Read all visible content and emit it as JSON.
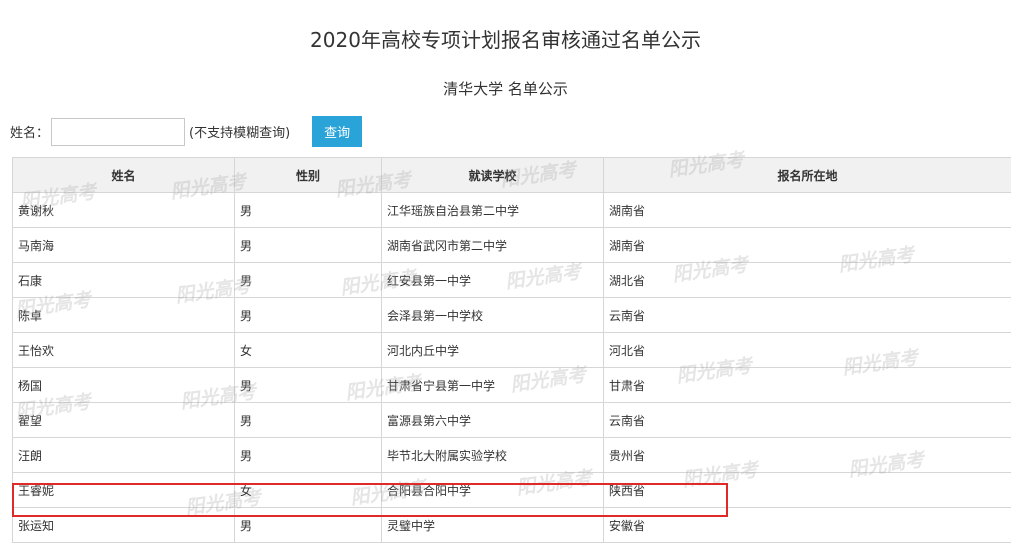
{
  "page": {
    "title": "2020年高校专项计划报名审核通过名单公示",
    "subtitle": "清华大学 名单公示"
  },
  "search": {
    "label": "姓名：",
    "value": "",
    "placeholder": "",
    "note": "(不支持模糊查询)",
    "button_label": "查询"
  },
  "table": {
    "headers": [
      "姓名",
      "性别",
      "就读学校",
      "报名所在地"
    ],
    "rows": [
      [
        "黄谢秋",
        "男",
        "江华瑶族自治县第二中学",
        "湖南省"
      ],
      [
        "马南海",
        "男",
        "湖南省武冈市第二中学",
        "湖南省"
      ],
      [
        "石康",
        "男",
        "红安县第一中学",
        "湖北省"
      ],
      [
        "陈卓",
        "男",
        "会泽县第一中学校",
        "云南省"
      ],
      [
        "王怡欢",
        "女",
        "河北内丘中学",
        "河北省"
      ],
      [
        "杨国",
        "男",
        "甘肃省宁县第一中学",
        "甘肃省"
      ],
      [
        "翟望",
        "男",
        "富源县第六中学",
        "云南省"
      ],
      [
        "汪朗",
        "男",
        "毕节北大附属实验学校",
        "贵州省"
      ],
      [
        "王睿妮",
        "女",
        "合阳县合阳中学",
        "陕西省"
      ],
      [
        "张运知",
        "男",
        "灵璧中学",
        "安徽省"
      ]
    ]
  },
  "watermark_text": "阳光高考",
  "colors": {
    "button_bg": "#2aa3d8",
    "highlight_border": "#e02a2a",
    "header_bg": "#f1f1f1"
  }
}
